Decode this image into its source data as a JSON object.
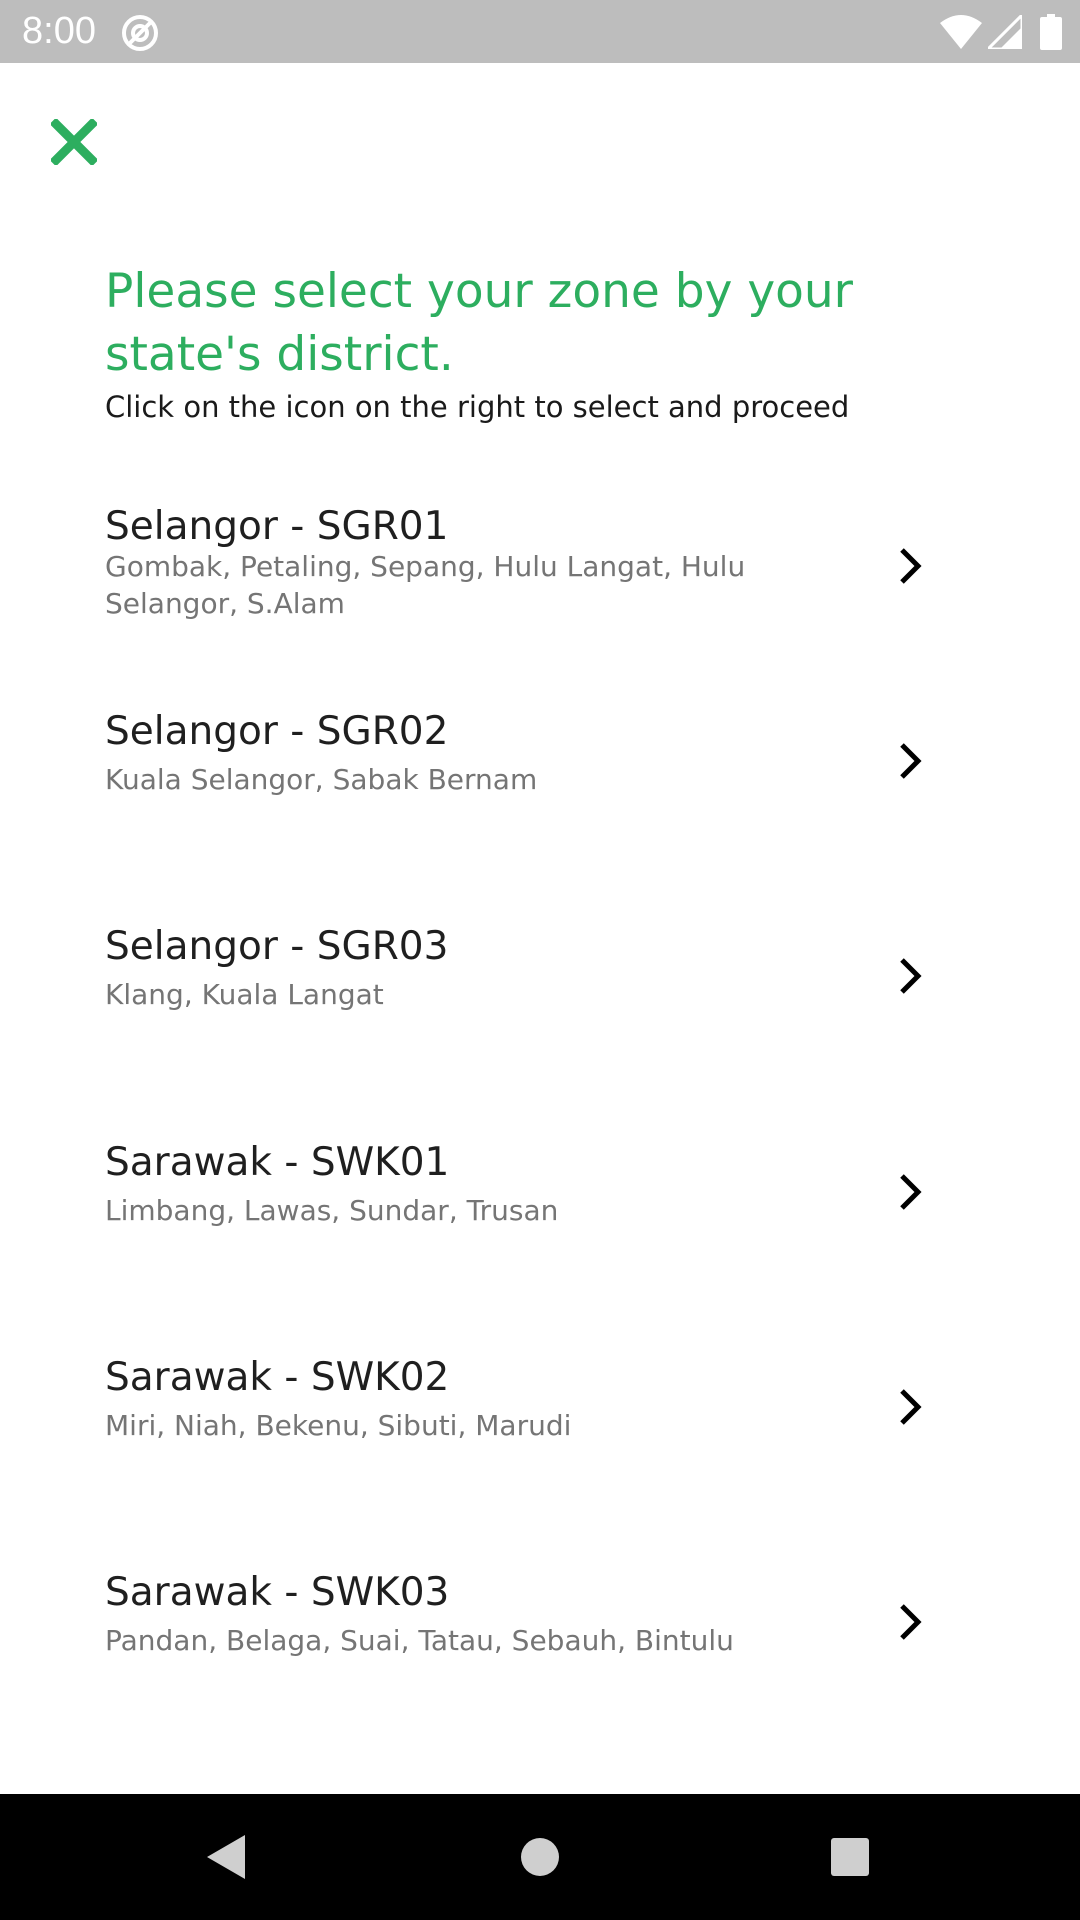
{
  "status_bar": {
    "time": "8:00",
    "icons": [
      "app-notification-icon",
      "wifi-icon",
      "cell-signal-icon",
      "battery-icon"
    ]
  },
  "header": {
    "close_icon": "close-icon",
    "title": "Please select your zone by your state's district.",
    "subtitle": "Click on the icon on the right to select and proceed"
  },
  "zones": [
    {
      "name": "Selangor - SGR01",
      "districts": "Gombak, Petaling, Sepang, Hulu Langat, Hulu Selangor, S.Alam"
    },
    {
      "name": "Selangor - SGR02",
      "districts": "Kuala Selangor, Sabak Bernam"
    },
    {
      "name": "Selangor - SGR03",
      "districts": "Klang, Kuala Langat"
    },
    {
      "name": "Sarawak - SWK01",
      "districts": "Limbang, Lawas, Sundar, Trusan"
    },
    {
      "name": "Sarawak - SWK02",
      "districts": "Miri, Niah, Bekenu, Sibuti, Marudi"
    },
    {
      "name": "Sarawak - SWK03",
      "districts": "Pandan, Belaga, Suai, Tatau, Sebauh, Bintulu"
    }
  ],
  "nav_bar": {
    "icons": [
      "back-icon",
      "home-icon",
      "recents-icon"
    ]
  },
  "colors": {
    "accent": "#2dae5f",
    "status_bar": "#bdbdbd",
    "nav_bar": "#000000",
    "primary_text": "#1f1f1f",
    "secondary_text": "#757575"
  }
}
